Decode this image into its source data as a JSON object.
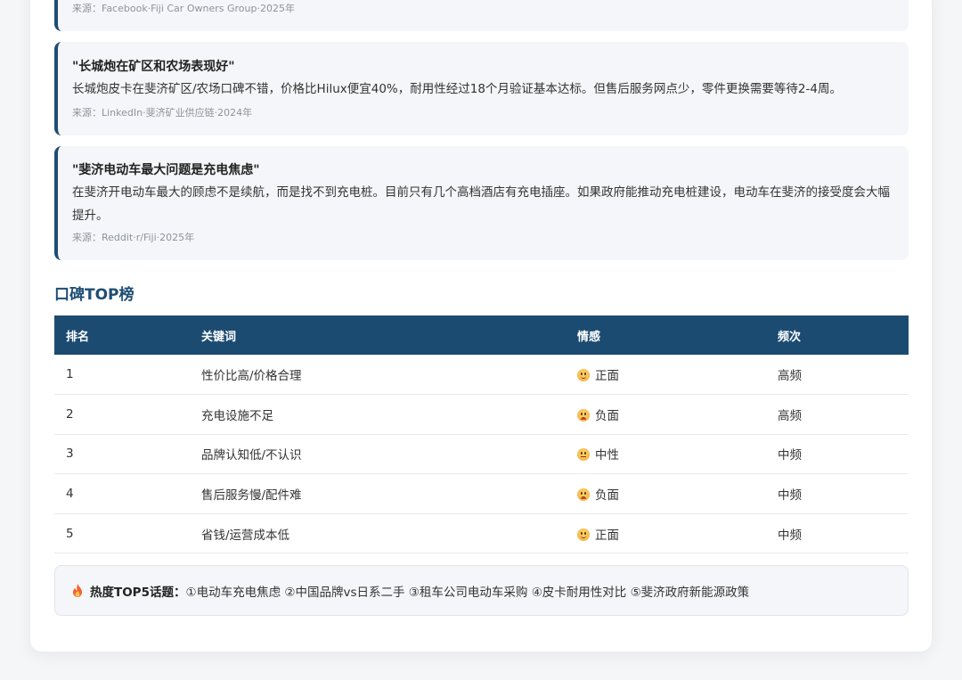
{
  "quotes": [
    {
      "title": "",
      "body": "",
      "source": "来源：Facebook·Fiji Car Owners Group·2025年"
    },
    {
      "title": "\"长城炮在矿区和农场表现好\"",
      "body": "长城炮皮卡在斐济矿区/农场口碑不错，价格比Hilux便宜40%，耐用性经过18个月验证基本达标。但售后服务网点少，零件更换需要等待2-4周。",
      "source": "来源：LinkedIn·斐济矿业供应链·2024年"
    },
    {
      "title": "\"斐济电动车最大问题是充电焦虑\"",
      "body": "在斐济开电动车最大的顾虑不是续航，而是找不到充电桩。目前只有几个高档酒店有充电插座。如果政府能推动充电桩建设，电动车在斐济的接受度会大幅提升。",
      "source": "来源：Reddit·r/Fiji·2025年"
    }
  ],
  "section_title": "口碑TOP榜",
  "table": {
    "headers": [
      "排名",
      "关键词",
      "情感",
      "频次"
    ],
    "rows": [
      {
        "rank": "1",
        "keyword": "性价比高/价格合理",
        "sentiment": "正面",
        "sentiment_type": "positive",
        "freq": "高频"
      },
      {
        "rank": "2",
        "keyword": "充电设施不足",
        "sentiment": "负面",
        "sentiment_type": "negative",
        "freq": "高频"
      },
      {
        "rank": "3",
        "keyword": "品牌认知低/不认识",
        "sentiment": "中性",
        "sentiment_type": "neutral",
        "freq": "中频"
      },
      {
        "rank": "4",
        "keyword": "售后服务慢/配件难",
        "sentiment": "负面",
        "sentiment_type": "negative",
        "freq": "中频"
      },
      {
        "rank": "5",
        "keyword": "省钱/运营成本低",
        "sentiment": "正面",
        "sentiment_type": "positive",
        "freq": "中频"
      }
    ]
  },
  "hot_topics": {
    "icon": "fire-icon",
    "label": "热度TOP5话题：",
    "text": "①电动车充电焦虑 ②中国品牌vs日系二手 ③租车公司电动车采购 ④皮卡耐用性对比 ⑤斐济政府新能源政策"
  },
  "colors": {
    "accent": "#1c4b72",
    "quote_border": "#1e4d74",
    "quote_bg": "#f5f6f9"
  }
}
